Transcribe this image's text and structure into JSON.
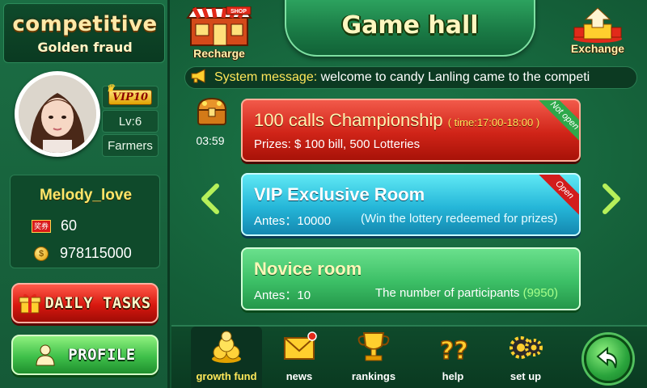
{
  "brand": {
    "title": "competitive",
    "subtitle": "Golden fraud"
  },
  "header": {
    "title": "Game hall",
    "recharge_label": "Recharge",
    "shop_sign": "SHOP",
    "exchange_label": "Exchange"
  },
  "profile": {
    "vip_badge": "VIP10",
    "level": "Lv:6",
    "rank": "Farmers",
    "username": "Melody_love",
    "ticket_icon_text": "奖券",
    "tickets": "60",
    "coins": "978115000"
  },
  "left_buttons": {
    "daily_tasks": "DAILY TASKS",
    "profile": "PROFILE"
  },
  "marquee": {
    "label": "System message:",
    "text": " welcome to candy Lanling came to the competi"
  },
  "timer": "03:59",
  "rooms": [
    {
      "title": "100 calls Championship",
      "time": "( time:17:00-18:00 )",
      "sub": "Prizes: $ 100 bill, 500 Lotteries",
      "ribbon": "Not open"
    },
    {
      "title": "VIP Exclusive Room",
      "sub": "Antes：10000",
      "note": "(Win the lottery redeemed for prizes)",
      "ribbon": "Open"
    },
    {
      "title": "Novice room",
      "sub": "Antes：10",
      "note_prefix": "The number of participants ",
      "count": "(9950)"
    }
  ],
  "nav": [
    {
      "label": "growth fund",
      "icon": "coin-pile-icon",
      "active": true
    },
    {
      "label": "news",
      "icon": "envelope-icon"
    },
    {
      "label": "rankings",
      "icon": "trophy-icon"
    },
    {
      "label": "help",
      "icon": "question-icon"
    },
    {
      "label": "set up",
      "icon": "gear-icon"
    }
  ],
  "colors": {
    "bg": "#145e38",
    "red_room": "#d02418",
    "cyan_room": "#25b6d8",
    "green_room": "#3cbf66",
    "gold_text": "#ffe66a"
  }
}
